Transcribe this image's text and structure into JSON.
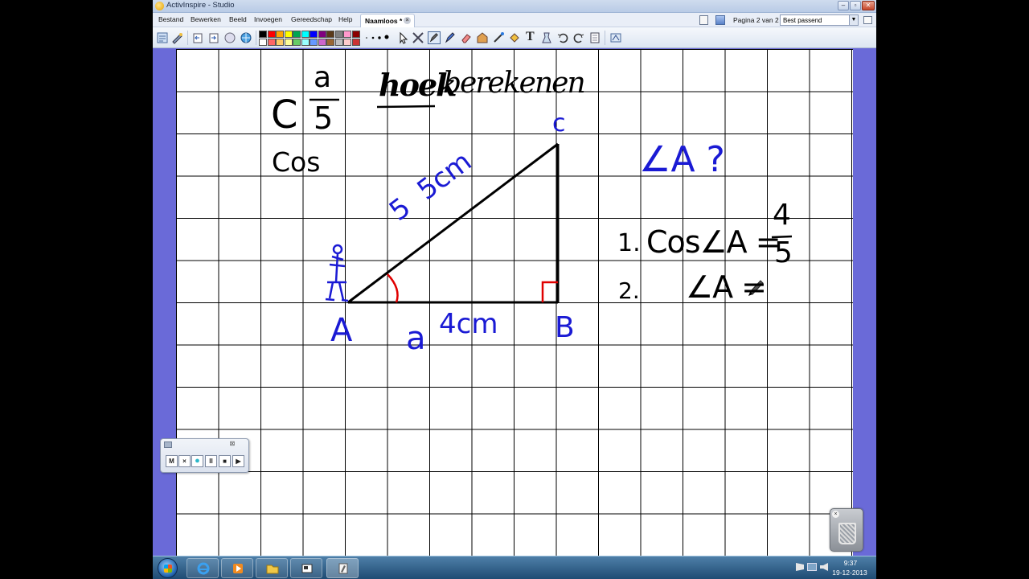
{
  "window": {
    "title": "ActivInspire - Studio"
  },
  "menu": {
    "items": [
      "Bestand",
      "Bewerken",
      "Beeld",
      "Invoegen",
      "Gereedschap",
      "Help"
    ],
    "document_tab": "Naamloos *",
    "page_counter": "Pagina 2 van 2",
    "zoom_value": "Best passend"
  },
  "palette_colors": [
    "#000000",
    "#ff0000",
    "#ffa500",
    "#ffff00",
    "#00a651",
    "#00ffff",
    "#0000ff",
    "#800080",
    "#5a3a1a",
    "#808080",
    "#ff99cc",
    "#8b0000",
    "#ffffff",
    "#ff6666",
    "#ffcc66",
    "#ffff99",
    "#66cc66",
    "#99ffff",
    "#6699ff",
    "#cc66cc",
    "#996633",
    "#c0c0c0",
    "#ffcccc",
    "#cc3333"
  ],
  "toolbar": {
    "text_tool_glyph": "T"
  },
  "board": {
    "fraction_letter": "C",
    "fraction_top": "a",
    "fraction_bottom": "5",
    "heading_part1": "hoek",
    "heading_part2": "berekenen",
    "cos_label": "Cos",
    "vertex_c": "c",
    "vertex_a": "A",
    "vertex_b": "B",
    "hypotenuse_label": "5  5cm",
    "adjacent_letter": "a",
    "adjacent_label": "4cm",
    "question": "∠A ?",
    "step1_number": "1.",
    "step1_expr": "Cos∠A =",
    "step1_num": "4",
    "step1_den": "5",
    "step2_number": "2.",
    "step2_expr": "∠A ="
  },
  "recorder": {
    "close_glyph": "⊠",
    "buttons": [
      "M",
      "×",
      "●",
      "II",
      "■",
      "▶"
    ]
  },
  "trash": {
    "close_glyph": "×"
  },
  "taskbar": {
    "time": "9:37",
    "date": "19-12-2013"
  },
  "colors": {
    "ink_black": "#000000",
    "ink_blue": "#1a1ad4",
    "ink_red": "#e00000",
    "frame": "#6a6ad8"
  }
}
